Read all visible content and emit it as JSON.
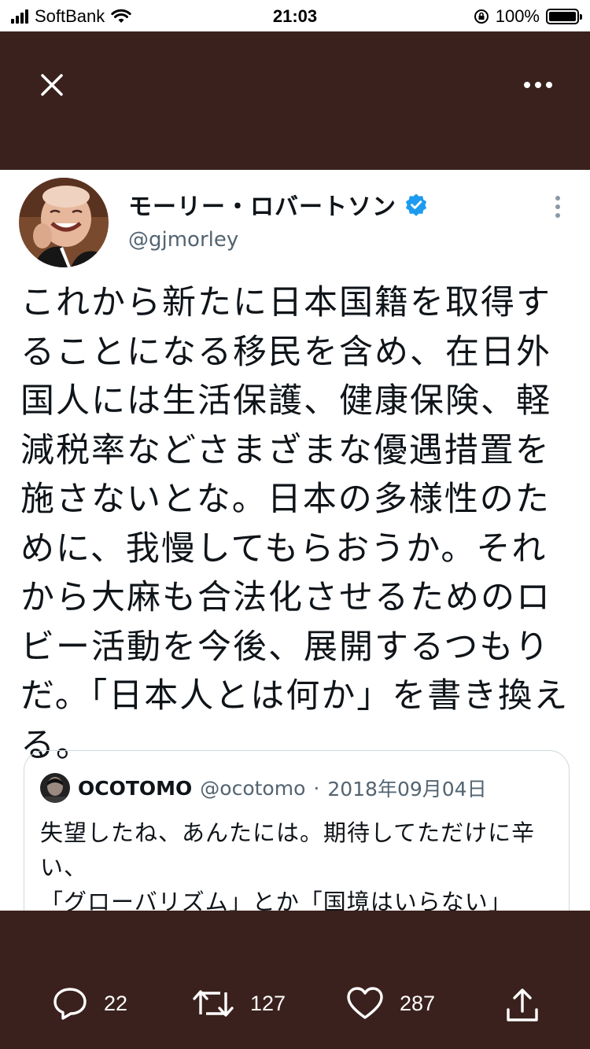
{
  "status_bar": {
    "carrier": "SoftBank",
    "time": "21:03",
    "battery": "100%"
  },
  "icons": {
    "signal": "signal-bars-icon",
    "wifi": "wifi-icon",
    "rotation_lock": "rotation-lock-icon",
    "battery": "battery-icon",
    "close": "close-icon",
    "more": "more-horizontal-icon",
    "verified": "verified-badge-icon",
    "kebab": "more-vertical-icon",
    "reply": "reply-icon",
    "retweet": "retweet-icon",
    "like": "heart-icon",
    "share": "share-icon"
  },
  "colors": {
    "overlay_bg": "#3a211d",
    "verified": "#1d9bf0",
    "text": "#0f1419",
    "secondary_text": "#536471"
  },
  "tweet": {
    "display_name": "モーリー・ロバートソン",
    "handle": "@gjmorley",
    "text": "これから新たに日本国籍を取得することになる移民を含め、在日外国人には生活保護、健康保険、軽減税率などさまざまな優遇措置を施さないとな。日本の多様性のために、我慢してもらおうか。それから大麻も合法化させるためのロビー活動を今後、展開するつもりだ。「日本人とは何か」を書き換える。",
    "quoted": {
      "name": "OCOTOMO",
      "handle": "@ocotomo",
      "separator": "·",
      "date": "2018年09月04日",
      "line1": "失望したね、あんたには。期待してただけに辛い、",
      "line2": "「グローバリズム」とか「国境はいらない」"
    }
  },
  "actions": {
    "reply_count": "22",
    "retweet_count": "127",
    "like_count": "287"
  }
}
